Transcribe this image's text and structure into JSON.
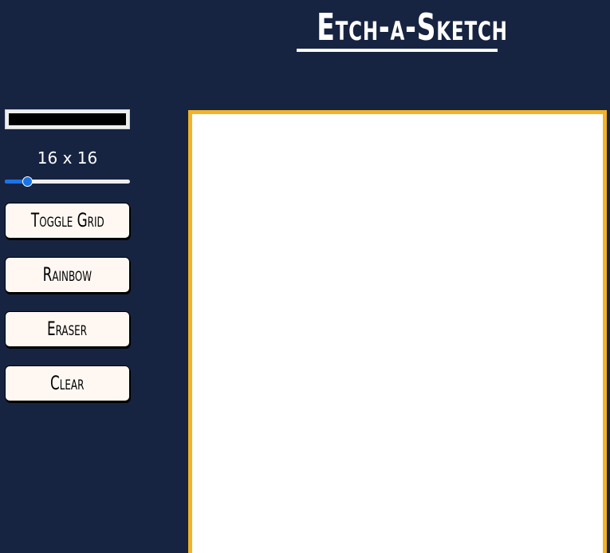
{
  "header": {
    "title": "Etch-a-Sketch"
  },
  "controls": {
    "color_picker": {
      "value": "#000000"
    },
    "grid_size_label": "16 x 16",
    "grid_size_slider": {
      "value": 16,
      "min": 1,
      "max": 100
    },
    "buttons": {
      "toggle_grid": "Toggle Grid",
      "rainbow": "Rainbow",
      "eraser": "Eraser",
      "clear": "Clear"
    }
  },
  "sketch_area": {
    "background": "#ffffff",
    "border_color": "#f2b328"
  },
  "colors": {
    "page_background": "#172441",
    "accent": "#1a73e8",
    "button_background": "#fff8f2"
  }
}
